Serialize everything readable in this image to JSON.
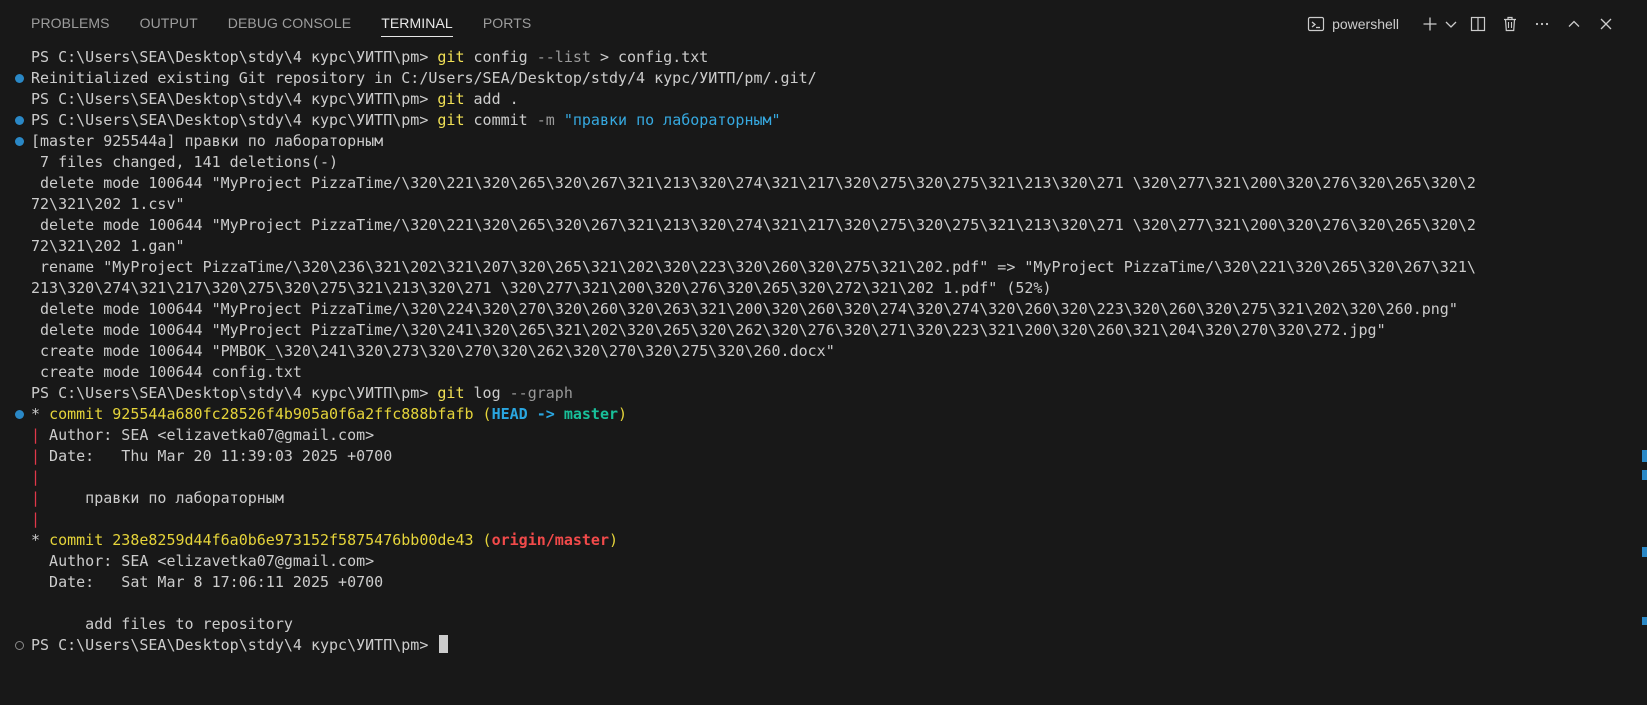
{
  "tabs": [
    "PROBLEMS",
    "OUTPUT",
    "DEBUG CONSOLE",
    "TERMINAL",
    "PORTS"
  ],
  "active_tab": "TERMINAL",
  "toolbar": {
    "shell_label": "powershell"
  },
  "terminal": {
    "prompt": "PS C:\\Users\\SEA\\Desktop\\stdy\\4 курс\\УИТП\\pm> ",
    "l1_cmd": "git",
    "l1_rest": " config ",
    "l1_opt": "--list",
    "l1_tail": " > config.txt",
    "l2": "Reinitialized existing Git repository in C:/Users/SEA/Desktop/stdy/4 курс/УИТП/pm/.git/",
    "l3_cmd": "git",
    "l3_rest": " add .",
    "l4_cmd": "git",
    "l4_rest": " commit ",
    "l4_opt": "-m",
    "l4_str": " \"правки по лабораторным\"",
    "l5": "[master 925544a] правки по лабораторным",
    "l6": " 7 files changed, 141 deletions(-)",
    "l7": " delete mode 100644 \"MyProject PizzaTime/\\320\\221\\320\\265\\320\\267\\321\\213\\320\\274\\321\\217\\320\\275\\320\\275\\321\\213\\320\\271 \\320\\277\\321\\200\\320\\276\\320\\265\\320\\2",
    "l8": "72\\321\\202 1.csv\"",
    "l9": " delete mode 100644 \"MyProject PizzaTime/\\320\\221\\320\\265\\320\\267\\321\\213\\320\\274\\321\\217\\320\\275\\320\\275\\321\\213\\320\\271 \\320\\277\\321\\200\\320\\276\\320\\265\\320\\2",
    "l10": "72\\321\\202 1.gan\"",
    "l11": " rename \"MyProject PizzaTime/\\320\\236\\321\\202\\321\\207\\320\\265\\321\\202\\320\\223\\320\\260\\320\\275\\321\\202.pdf\" => \"MyProject PizzaTime/\\320\\221\\320\\265\\320\\267\\321\\",
    "l12": "213\\320\\274\\321\\217\\320\\275\\320\\275\\321\\213\\320\\271 \\320\\277\\321\\200\\320\\276\\320\\265\\320\\272\\321\\202 1.pdf\" (52%)",
    "l13": " delete mode 100644 \"MyProject PizzaTime/\\320\\224\\320\\270\\320\\260\\320\\263\\321\\200\\320\\260\\320\\274\\320\\274\\320\\260\\320\\223\\320\\260\\320\\275\\321\\202\\320\\260.png\"",
    "l14": " delete mode 100644 \"MyProject PizzaTime/\\320\\241\\320\\265\\321\\202\\320\\265\\320\\262\\320\\276\\320\\271\\320\\223\\321\\200\\320\\260\\321\\204\\320\\270\\320\\272.jpg\"",
    "l15": " create mode 100644 \"PMBOK_\\320\\241\\320\\273\\320\\270\\320\\262\\320\\270\\320\\275\\320\\260.docx\"",
    "l16": " create mode 100644 config.txt",
    "l17_cmd": "git",
    "l17_rest": " log ",
    "l17_opt": "--graph",
    "c1_star": "* ",
    "c1_word": "commit 925544a680fc28526f4b905a0f6a2ffc888bfafb (",
    "c1_head": "HEAD -> ",
    "c1_branch": "master",
    "c1_close": ")",
    "pipe": "|",
    "c1_author": " Author: SEA <elizavetka07@gmail.com>",
    "c1_date": " Date:   Thu Mar 20 11:39:03 2025 +0700",
    "c1_msg": "     правки по лабораторным",
    "c2_star": "* ",
    "c2_word": "commit 238e8259d44f6a0b6e973152f5875476bb00de43 (",
    "c2_branch": "origin/master",
    "c2_close": ")",
    "c2_author": "  Author: SEA <elizavetka07@gmail.com>",
    "c2_date": "  Date:   Sat Mar 8 17:06:11 2025 +0700",
    "c2_msg": "      add files to repository"
  }
}
